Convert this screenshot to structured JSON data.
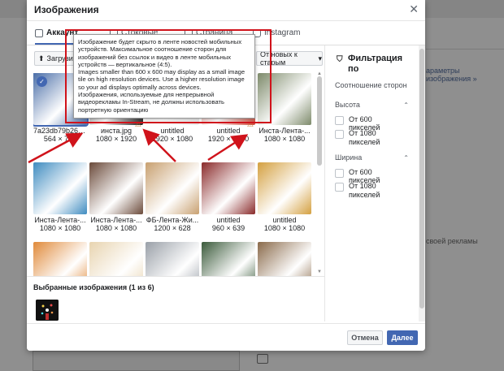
{
  "modal": {
    "title": "Изображения",
    "tabs": [
      {
        "label": "Аккаунт",
        "active": true
      },
      {
        "label": "Стоковые",
        "active": false
      },
      {
        "label": "Страница",
        "active": false
      },
      {
        "label": "Instagram",
        "active": false
      }
    ],
    "upload_label": "Загрузить",
    "sort_label": "От новых к старым",
    "selected_label": "Выбранные изображения (1 из 6)",
    "cancel_label": "Отмена",
    "next_label": "Далее"
  },
  "tooltip": {
    "line1": "Изображение будет скрыто в ленте новостей мобильных устройств. Максимальное соотношение сторон для изображений без ссылок и видео в ленте мобильных устройств — вертикальное (4:5).",
    "line2": "Images smaller than 600 x 600 may display as a small image tile on high resolution devices. Use a higher resolution image so your ad displays optimally across devices.",
    "line3": "Изображения, используемые для непрерывной видеорекламы In-Stream, не должны использовать портретную ориентацию"
  },
  "images": [
    {
      "name": "7a23db79b263...",
      "dims": "564 × 796",
      "color": "#4b6fa8",
      "selected": true,
      "warning": false
    },
    {
      "name": "инста.jpg",
      "dims": "1080 × 1920",
      "color": "#1a1a1a",
      "selected": false,
      "warning": true
    },
    {
      "name": "untitled",
      "dims": "1920 × 1080",
      "color": "#e8e8e8",
      "selected": false,
      "warning": false
    },
    {
      "name": "untitled",
      "dims": "1920 × 1080",
      "color": "#c94a3a",
      "selected": false,
      "warning": true
    },
    {
      "name": "Инста-Лента-...",
      "dims": "1080 × 1080",
      "color": "#7d8a6a",
      "selected": false,
      "warning": false
    },
    {
      "name": "Инста-Лента-...",
      "dims": "1080 × 1080",
      "color": "#3f8cc0",
      "selected": false,
      "warning": false
    },
    {
      "name": "Инста-Лента-...",
      "dims": "1080 × 1080",
      "color": "#6b4a3a",
      "selected": false,
      "warning": false
    },
    {
      "name": "ФБ-Лента-Жи...",
      "dims": "1200 × 628",
      "color": "#c8a070",
      "selected": false,
      "warning": false
    },
    {
      "name": "untitled",
      "dims": "960 × 639",
      "color": "#8a2a2a",
      "selected": false,
      "warning": false
    },
    {
      "name": "untitled",
      "dims": "1080 × 1080",
      "color": "#d4a040",
      "selected": false,
      "warning": false
    },
    {
      "name": "",
      "dims": "",
      "color": "#e08a3a",
      "selected": false,
      "warning": false
    },
    {
      "name": "",
      "dims": "",
      "color": "#e8d4b0",
      "selected": false,
      "warning": false
    },
    {
      "name": "",
      "dims": "",
      "color": "#9aa0a8",
      "selected": false,
      "warning": false
    },
    {
      "name": "",
      "dims": "",
      "color": "#3a5a3a",
      "selected": false,
      "warning": false
    },
    {
      "name": "",
      "dims": "",
      "color": "#8a6a4a",
      "selected": false,
      "warning": false
    }
  ],
  "filter": {
    "title": "Фильтрация по",
    "aspect_label": "Соотношение сторон",
    "height_label": "Высота",
    "height_opt1": "От 600 пикселей",
    "height_opt2": "От 1080 пикселей",
    "width_label": "Ширина",
    "width_opt1": "От 600 пикселей",
    "width_opt2": "От 1080 пикселей"
  },
  "background": {
    "right_link": "араметры изображения »",
    "right_text": "своей рекламы"
  },
  "colors": {
    "accent": "#4267b2",
    "annotation": "#d0131b",
    "warning": "#c6742b"
  }
}
